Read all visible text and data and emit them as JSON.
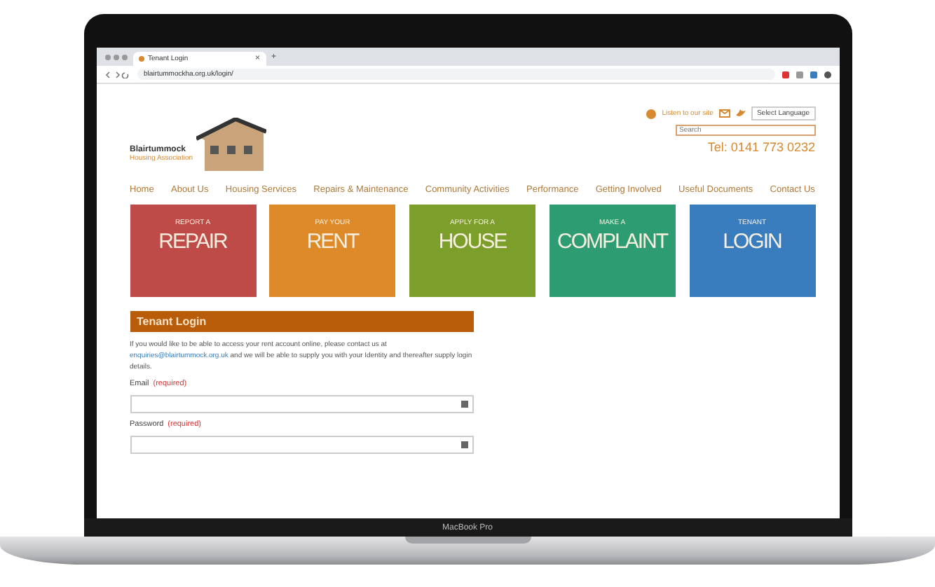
{
  "device": {
    "label": "MacBook Pro"
  },
  "browser": {
    "tab_title": "Tenant Login",
    "close": "×",
    "new_tab": "+",
    "url": "blairtummockha.org.uk/login/"
  },
  "header": {
    "logo_name": "Blairtummock",
    "logo_sub": "Housing Association",
    "listen": "Listen to our site",
    "language": "Select Language",
    "search_placeholder": "Search",
    "phone": "Tel: 0141 773 0232"
  },
  "nav": [
    "Home",
    "About Us",
    "Housing Services",
    "Repairs & Maintenance",
    "Community Activities",
    "Performance",
    "Getting Involved",
    "Useful Documents",
    "Contact Us"
  ],
  "tiles": [
    {
      "small": "REPORT A",
      "big": "REPAIR",
      "color": "#bf4b48"
    },
    {
      "small": "PAY YOUR",
      "big": "RENT",
      "color": "#de8a28"
    },
    {
      "small": "APPLY FOR A",
      "big": "HOUSE",
      "color": "#7b9f2a"
    },
    {
      "small": "MAKE A",
      "big": "COMPLAINT",
      "color": "#2e9c72"
    },
    {
      "small": "TENANT",
      "big": "LOGIN",
      "color": "#3a7dbf"
    }
  ],
  "login": {
    "title": "Tenant Login",
    "intro": "If you would like to be able to access your rent account online, please contact us at",
    "email": "enquiries@blairtummock.org.uk",
    "intro_rest": "and we will be able to supply you with your Identity and thereafter supply login details.",
    "fields": [
      {
        "label": "Email",
        "required": "(required)"
      },
      {
        "label": "Password",
        "required": "(required)"
      }
    ]
  }
}
